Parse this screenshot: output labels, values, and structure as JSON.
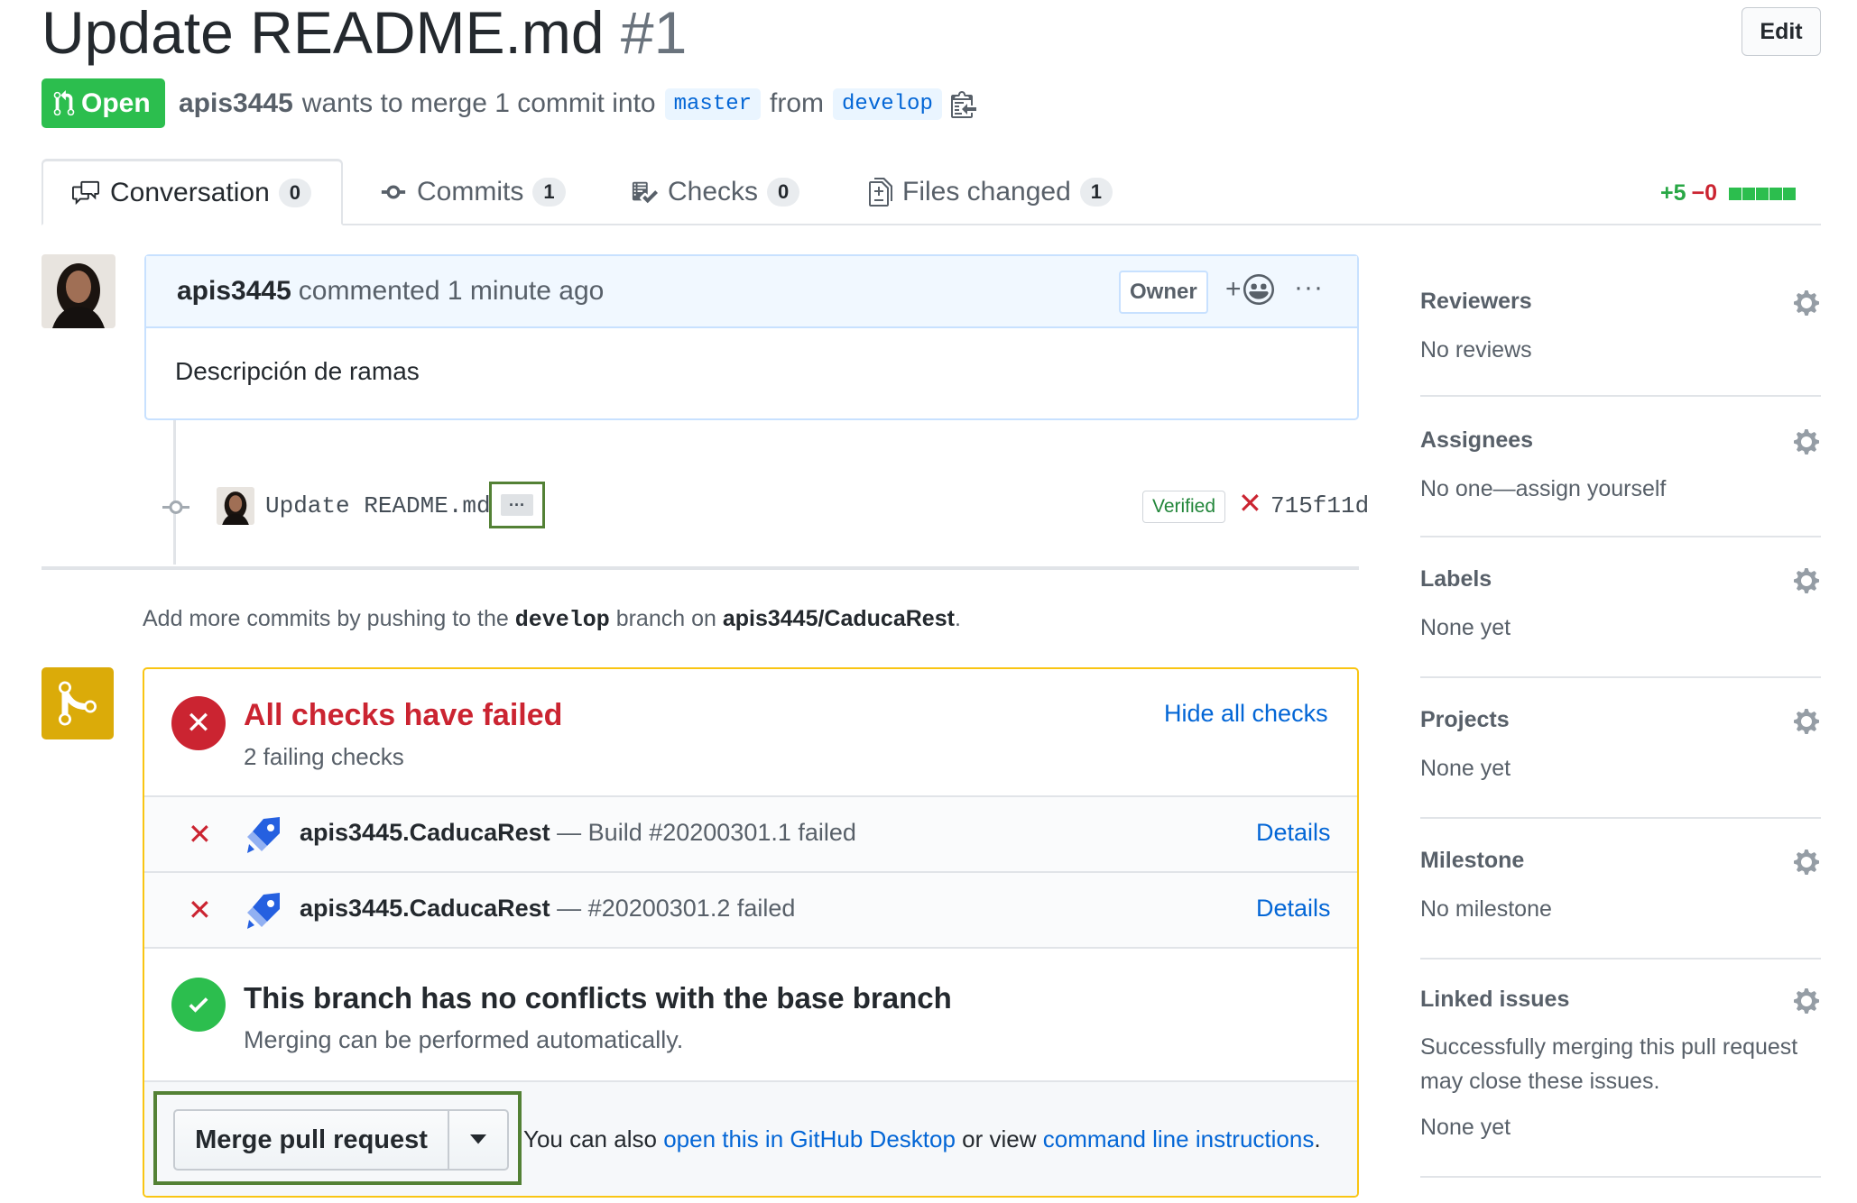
{
  "header": {
    "title": "Update README.md",
    "number": "#1",
    "edit_label": "Edit",
    "state": "Open",
    "author": "apis3445",
    "merge_text": "wants to merge 1 commit into",
    "base_branch": "master",
    "from_text": "from",
    "head_branch": "develop"
  },
  "tabs": [
    {
      "label": "Conversation",
      "count": "0",
      "icon": "comment-discussion-icon"
    },
    {
      "label": "Commits",
      "count": "1",
      "icon": "git-commit-icon"
    },
    {
      "label": "Checks",
      "count": "0",
      "icon": "checklist-icon"
    },
    {
      "label": "Files changed",
      "count": "1",
      "icon": "file-diff-icon"
    }
  ],
  "diffstat": {
    "additions": "+5",
    "deletions": "−0"
  },
  "comment": {
    "author": "apis3445",
    "meta": "commented 1 minute ago",
    "role": "Owner",
    "react_label": "+",
    "more_label": "···",
    "body": "Descripción de ramas"
  },
  "commit": {
    "message": "Update README.md",
    "ellipsis": "···",
    "verified": "Verified",
    "status_glyph": "✕",
    "sha": "715f11d"
  },
  "push_hint": {
    "prefix": "Add more commits by pushing to the",
    "branch": "develop",
    "middle": "branch on",
    "repo": "apis3445/CaducaRest",
    "suffix": "."
  },
  "checks": {
    "title": "All checks have failed",
    "subtitle": "2 failing checks",
    "toggle_label": "Hide all checks",
    "items": [
      {
        "name": "apis3445.CaducaRest",
        "desc": "— Build #20200301.1 failed",
        "link": "Details"
      },
      {
        "name": "apis3445.CaducaRest",
        "desc": "— #20200301.2 failed",
        "link": "Details"
      }
    ]
  },
  "conflicts": {
    "title": "This branch has no conflicts with the base branch",
    "subtitle": "Merging can be performed automatically."
  },
  "merge": {
    "button_label": "Merge pull request",
    "alt_prefix": "You can also",
    "desktop_link": "open this in GitHub Desktop",
    "alt_middle": "or view",
    "cli_link": "command line instructions",
    "alt_suffix": "."
  },
  "sidebar": [
    {
      "title": "Reviewers",
      "value": "No reviews"
    },
    {
      "title": "Assignees",
      "value": "No one—assign yourself"
    },
    {
      "title": "Labels",
      "value": "None yet"
    },
    {
      "title": "Projects",
      "value": "None yet"
    },
    {
      "title": "Milestone",
      "value": "No milestone"
    },
    {
      "title": "Linked issues",
      "value": "Successfully merging this pull request may close these issues.",
      "value2": "None yet"
    }
  ],
  "colors": {
    "open_green": "#2cbe4e",
    "fail_red": "#cb2431",
    "link_blue": "#0366d6",
    "pending_yellow": "#dbab09",
    "highlight_green": "#538135"
  }
}
